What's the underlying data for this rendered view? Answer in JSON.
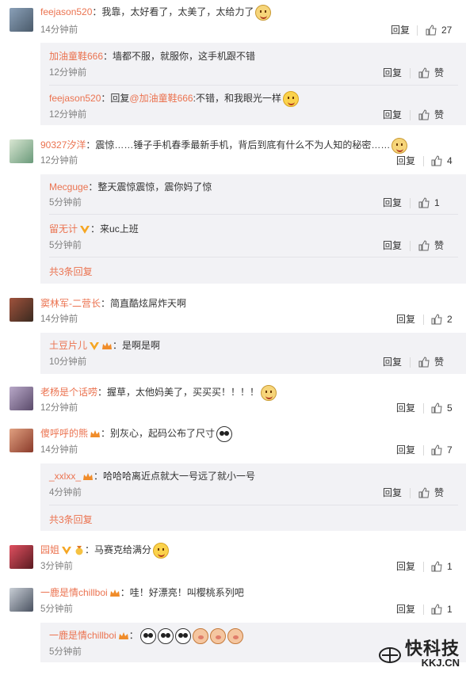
{
  "actions": {
    "reply": "回复",
    "like": "赞"
  },
  "comments": [
    {
      "user": "feejason520",
      "text": "：我靠，太好看了，太美了，太给力了",
      "time": "14分钟前",
      "likes": "27",
      "emoji": "dog-icon",
      "replies": [
        {
          "user": "加油童鞋666",
          "text": "：墙都不服，就服你，这手机跟不错",
          "time": "12分钟前",
          "likes": "赞"
        },
        {
          "user": "feejason520",
          "pre": "：回复",
          "mention": "@加油童鞋666",
          "text": ":不错，和我眼光一样",
          "time": "12分钟前",
          "likes": "赞",
          "emoji": "happy-icon"
        }
      ]
    },
    {
      "user": "90327汐洋",
      "text": "：震惊……锤子手机春季最新手机，背后到底有什么不为人知的秘密……",
      "time": "12分钟前",
      "likes": "4",
      "emoji": "dog-icon",
      "replies": [
        {
          "user": "Mecguge",
          "text": "：整天震惊震惊，震你妈了惊",
          "time": "5分钟前",
          "likes": "1"
        },
        {
          "user": "留无计",
          "text": "：来uc上班",
          "time": "5分钟前",
          "likes": "赞",
          "badge": "v-icon"
        }
      ],
      "more": "共3条回复"
    },
    {
      "user": "窦林军-二营长",
      "text": "：简直酷炫屌炸天啊",
      "time": "14分钟前",
      "likes": "2",
      "replies": [
        {
          "user": "土豆片儿",
          "text": "：是啊是啊",
          "time": "10分钟前",
          "likes": "赞",
          "badge": "v-icon"
        }
      ]
    },
    {
      "user": "老杨是个话唠",
      "text": "：握草，太他妈美了，买买买！！！！",
      "time": "12分钟前",
      "likes": "5",
      "emoji": "dog-icon"
    },
    {
      "user": "傻呼呼的熊",
      "text": "：别灰心，起码公布了尺寸",
      "time": "14分钟前",
      "likes": "7",
      "emoji": "panda-icon",
      "badge": "crown-icon",
      "replies": [
        {
          "user": "_xxlxx_",
          "text": "：哈哈哈离近点就大一号远了就小一号",
          "time": "4分钟前",
          "likes": "赞",
          "badge": "crown-icon"
        }
      ],
      "more": "共3条回复"
    },
    {
      "user": "园姐",
      "text": "：马赛克给满分",
      "time": "3分钟前",
      "likes": "1",
      "emoji": "happy-icon",
      "badge": "v-icon"
    },
    {
      "user": "一鹿是情chillboi",
      "text": "：哇！好漂亮！叫樱桃系列吧",
      "time": "5分钟前",
      "likes": "1",
      "badge": "crown-icon",
      "replies": [
        {
          "user": "一鹿是情chillboi",
          "text": "：",
          "time": "5分钟前",
          "badge": "crown-icon"
        }
      ]
    }
  ],
  "watermark": {
    "brand": "快科技",
    "domain": "KKJ.CN"
  },
  "colors": {
    "username": "#eb7350",
    "subbox": "#f2f2f5",
    "time": "#808080"
  }
}
